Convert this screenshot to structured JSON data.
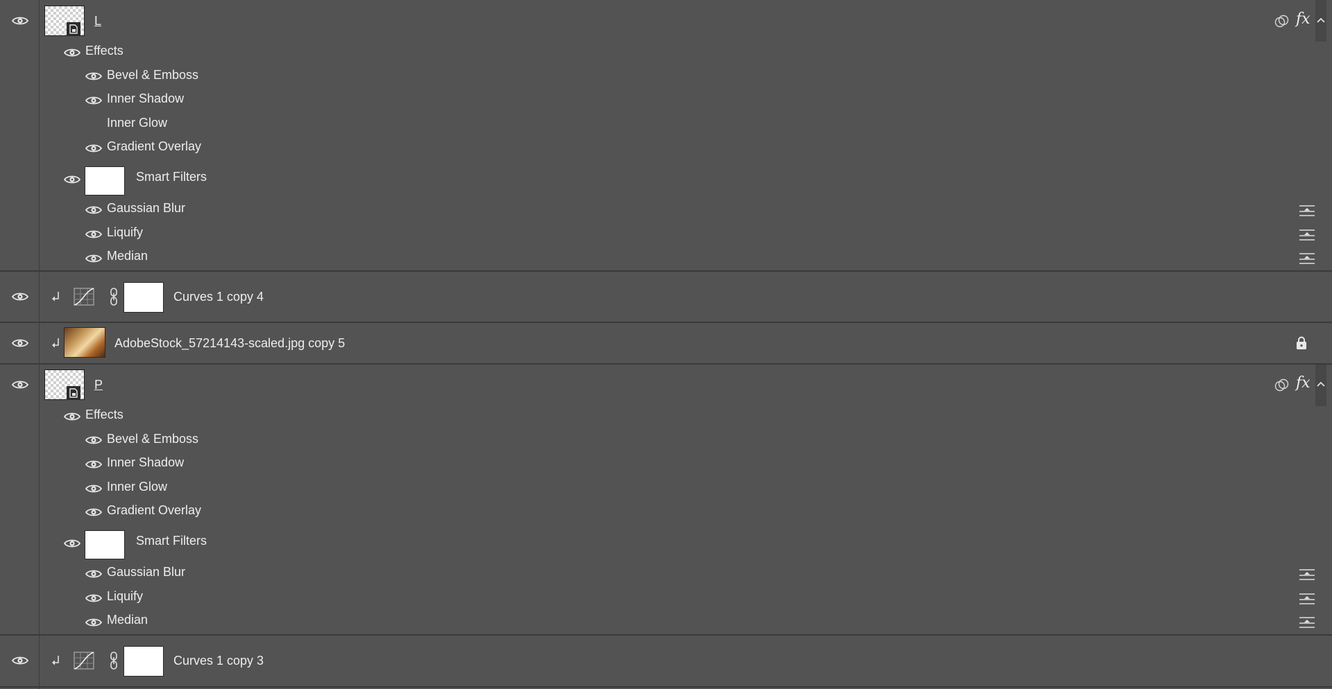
{
  "layers": {
    "L": {
      "name": "L",
      "effects_label": "Effects",
      "effects": [
        "Bevel & Emboss",
        "Inner Shadow",
        "Inner Glow",
        "Gradient Overlay"
      ],
      "smart_filters_label": "Smart Filters",
      "filters": [
        "Gaussian Blur",
        "Liquify",
        "Median"
      ],
      "fx_label": "fx"
    },
    "curves4": {
      "name": "Curves 1 copy 4"
    },
    "photo": {
      "name": "AdobeStock_57214143-scaled.jpg copy 5"
    },
    "P": {
      "name": "P",
      "effects_label": "Effects",
      "effects": [
        "Bevel & Emboss",
        "Inner Shadow",
        "Inner Glow",
        "Gradient Overlay"
      ],
      "smart_filters_label": "Smart Filters",
      "filters": [
        "Gaussian Blur",
        "Liquify",
        "Median"
      ],
      "fx_label": "fx"
    },
    "curves3": {
      "name": "Curves 1 copy 3"
    }
  },
  "icons": {
    "visibility": "eye-icon",
    "smart_object": "smart-object-badge-icon",
    "fx": "fx-icon",
    "blend": "blend-circles-icon",
    "collapse": "chevron-up-icon",
    "filter_options": "filter-blending-options-icon",
    "clip": "clipping-arrow-icon",
    "curves": "curves-adjustment-icon",
    "link": "chain-link-icon",
    "lock": "lock-icon"
  },
  "colors": {
    "panel_bg": "#535353",
    "separator": "#3a3a3a",
    "text": "#ededed"
  }
}
